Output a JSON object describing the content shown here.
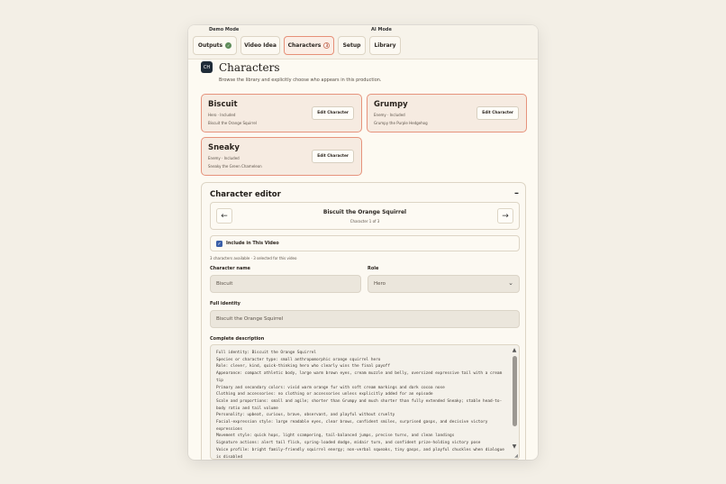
{
  "behind": {
    "left_mode": "Demo Mode",
    "right_mode": "AI Mode"
  },
  "tabs": [
    {
      "label": "Outputs",
      "badge": "✓"
    },
    {
      "label": "Video Idea"
    },
    {
      "label": "Characters",
      "badge": "3"
    },
    {
      "label": "Setup"
    },
    {
      "label": "Library"
    }
  ],
  "header": {
    "icon_text": "CH",
    "title": "Characters",
    "subtitle": "Browse the library and explicitly choose who appears in this production."
  },
  "cards": [
    {
      "name": "Biscuit",
      "meta": "Hero · Included",
      "desc": "Biscuit the Orange Squirrel",
      "edit_label": "Edit Character"
    },
    {
      "name": "Grumpy",
      "meta": "Enemy · Included",
      "desc": "Grumpy the Purple Hedgehog",
      "edit_label": "Edit Character"
    },
    {
      "name": "Sneaky",
      "meta": "Enemy · Included",
      "desc": "Sneaky the Green Chameleon",
      "edit_label": "Edit Character"
    }
  ],
  "editor": {
    "title": "Character editor",
    "collapse": "–",
    "prev_icon": "←",
    "next_icon": "→",
    "current_name": "Biscuit the Orange Squirrel",
    "current_count": "Character 1 of 3",
    "include_label": "Include in This Video",
    "availability": "3 characters available · 3 selected for this video",
    "name_label": "Character name",
    "name_value": "Biscuit",
    "role_label": "Role",
    "role_value": "Hero",
    "identity_label": "Full identity",
    "identity_value": "Biscuit the Orange Squirrel",
    "description_label": "Complete description",
    "description_text": "Full identity: Biscuit the Orange Squirrel\nSpecies or character type: small anthropomorphic orange squirrel hero\nRole: clever, kind, quick-thinking hero who clearly wins the final payoff\nAppearance: compact athletic body, large warm brown eyes, cream muzzle and belly, oversized expressive tail with a cream tip\nPrimary and secondary colors: vivid warm orange fur with soft cream markings and dark cocoa nose\nClothing and accessories: no clothing or accessories unless explicitly added for an episode\nScale and proportions: small and agile; shorter than Grumpy and much shorter than fully extended Sneaky; stable head-to-body ratio and tail volume\nPersonality: upbeat, curious, brave, observant, and playful without cruelty\nFacial-expression style: large readable eyes, clear brows, confident smiles, surprised gasps, and decisive victory expressions\nMovement style: quick hops, light scampering, tail-balanced jumps, precise turns, and clean landings\nSignature actions: alert tail flick, spring-loaded dodge, midair turn, and confident prize-holding victory pose\nVoice profile: bright family-friendly squirrel energy; non-verbal squeaks, tiny gasps, and playful chuckles when dialogue is disabled"
  }
}
